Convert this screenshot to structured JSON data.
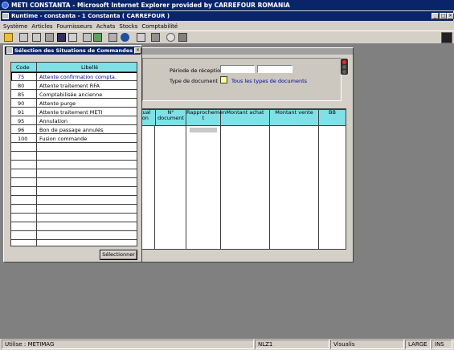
{
  "app": {
    "title": "METI CONSTANTA - Microsoft Internet Explorer provided by CARREFOUR ROMANIA"
  },
  "inner": {
    "title": "Runtime - constanta -  1  Constanta ( CARREFOUR )"
  },
  "menu": [
    "Système",
    "Articles",
    "Fournisseurs",
    "Achats",
    "Stocks",
    "Comptabilité"
  ],
  "form": {
    "periode_label": "Période de réception :",
    "type_label": "Type de document",
    "type_value": "Tous les types de documents"
  },
  "grid": {
    "headers": [
      "tual\nion",
      "N° document",
      "Rapprochemen\nt",
      "Montant achat",
      "Montant vente",
      "BB"
    ]
  },
  "dialog": {
    "title": "Sélection des Situations de Commandes",
    "col_code": "Code",
    "col_libelle": "Libellé",
    "rows": [
      {
        "code": "75",
        "libelle": "Attente confirmation compta."
      },
      {
        "code": "80",
        "libelle": "Attente traitement RFA"
      },
      {
        "code": "85",
        "libelle": "Comptabilisée ancienne"
      },
      {
        "code": "90",
        "libelle": "Attente purge"
      },
      {
        "code": "91",
        "libelle": "Attente traitement METI"
      },
      {
        "code": "95",
        "libelle": "Annulation"
      },
      {
        "code": "96",
        "libelle": "Bon de passage annulés"
      },
      {
        "code": "100",
        "libelle": "Fusion commande"
      }
    ],
    "select_button": "Sélectionner"
  },
  "status": {
    "user": "Utilise : METIMAG",
    "server": "NLZ1",
    "mode": "Visualis",
    "size": "LARGE",
    "ins": "INS"
  },
  "colors": {
    "titlebar": "#0a246a",
    "header_cyan": "#7fe0e8",
    "selected_text": "#0000a0",
    "chrome": "#d4d0c8",
    "desktop": "#808080"
  }
}
